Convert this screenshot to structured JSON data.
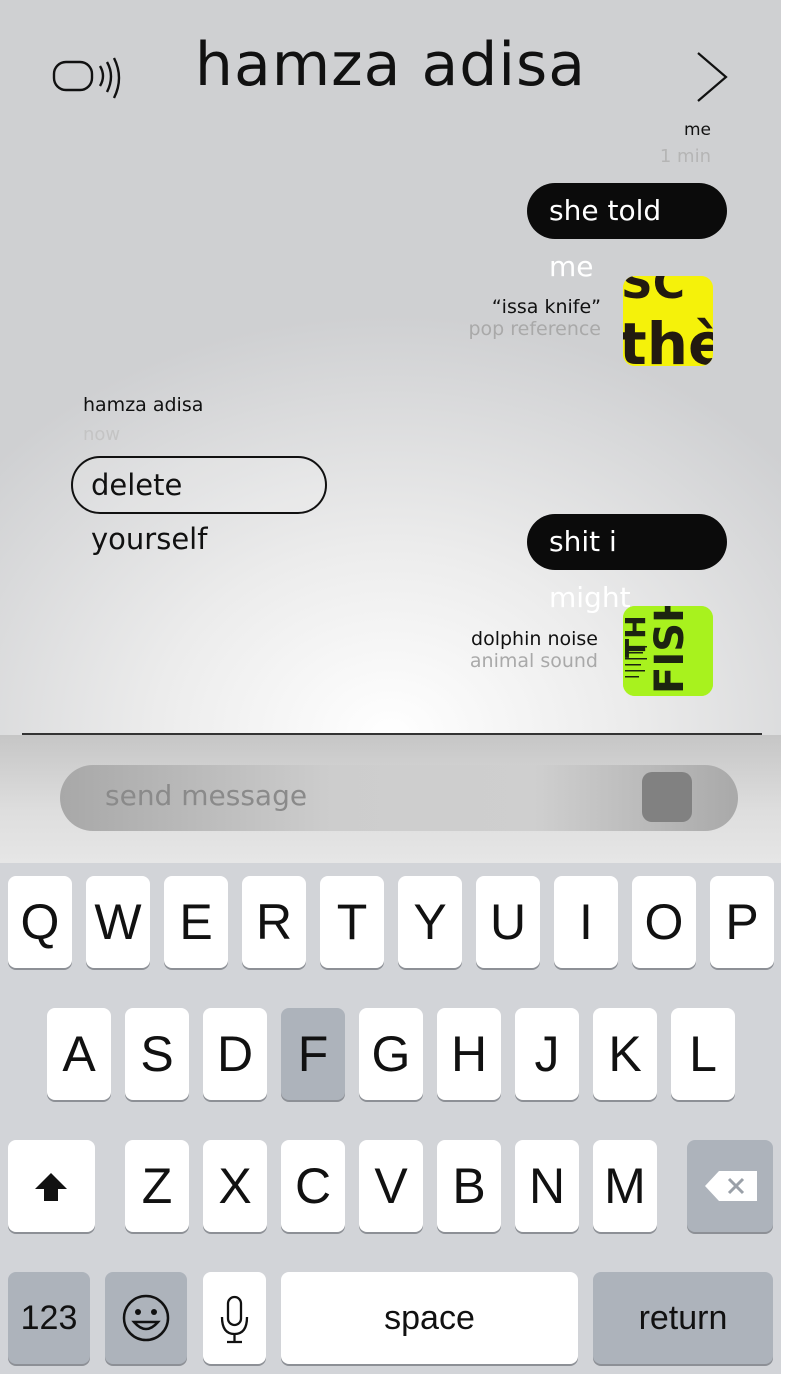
{
  "header": {
    "title": "hamza adisa"
  },
  "messages": {
    "me_meta": {
      "name": "me",
      "time": "1 min"
    },
    "msg1": "she told me",
    "att1": {
      "name": "“issa knife”",
      "sub": "pop reference",
      "thumb_text": "thè"
    },
    "them_meta": {
      "name": "hamza adisa",
      "time": "now"
    },
    "msg2": "delete yourself",
    "msg3": "shit i might",
    "att2": {
      "name": "dolphin noise",
      "sub": "animal sound",
      "thumb_text": "FISH"
    }
  },
  "composer": {
    "placeholder": "send message"
  },
  "keyboard": {
    "row1": [
      "Q",
      "W",
      "E",
      "R",
      "T",
      "Y",
      "U",
      "I",
      "O",
      "P"
    ],
    "row2": [
      "A",
      "S",
      "D",
      "F",
      "G",
      "H",
      "J",
      "K",
      "L"
    ],
    "row3": [
      "Z",
      "X",
      "C",
      "V",
      "B",
      "N",
      "M"
    ],
    "num": "123",
    "space": "space",
    "return": "return",
    "pressed_key": "F"
  },
  "colors": {
    "accent_yellow": "#f5f20a",
    "accent_green": "#a8f21e",
    "bubble_dark": "#0b0b0b"
  }
}
